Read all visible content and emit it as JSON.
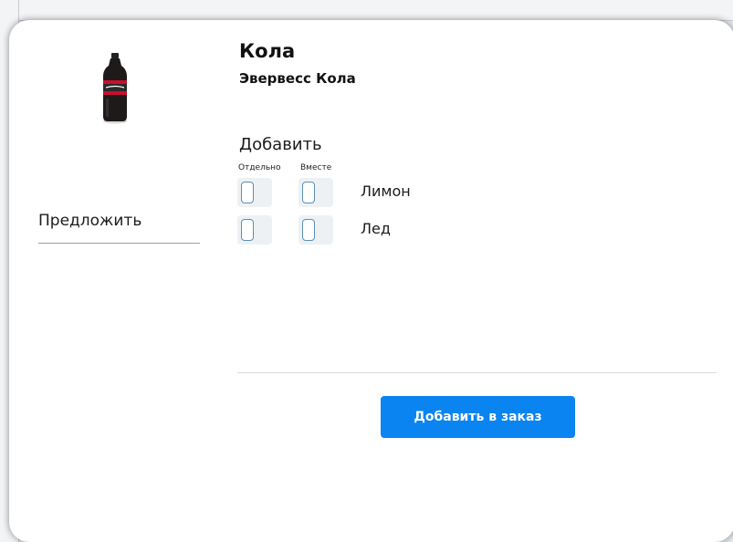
{
  "product": {
    "title": "Кола",
    "subtitle": "Эвервесс Кола",
    "image_icon": "cola-bottle-icon"
  },
  "suggest": {
    "label": "Предложить"
  },
  "add_section": {
    "heading": "Добавить",
    "col_separate": "Отдельно",
    "col_together": "Вместе",
    "options": [
      {
        "label": "Лимон",
        "separate": false,
        "together": false
      },
      {
        "label": "Лед",
        "separate": false,
        "together": false
      }
    ]
  },
  "actions": {
    "add_to_order": "Добавить в заказ"
  },
  "colors": {
    "accent": "#0a84f0",
    "checkbox_border": "#5a8fb8"
  }
}
